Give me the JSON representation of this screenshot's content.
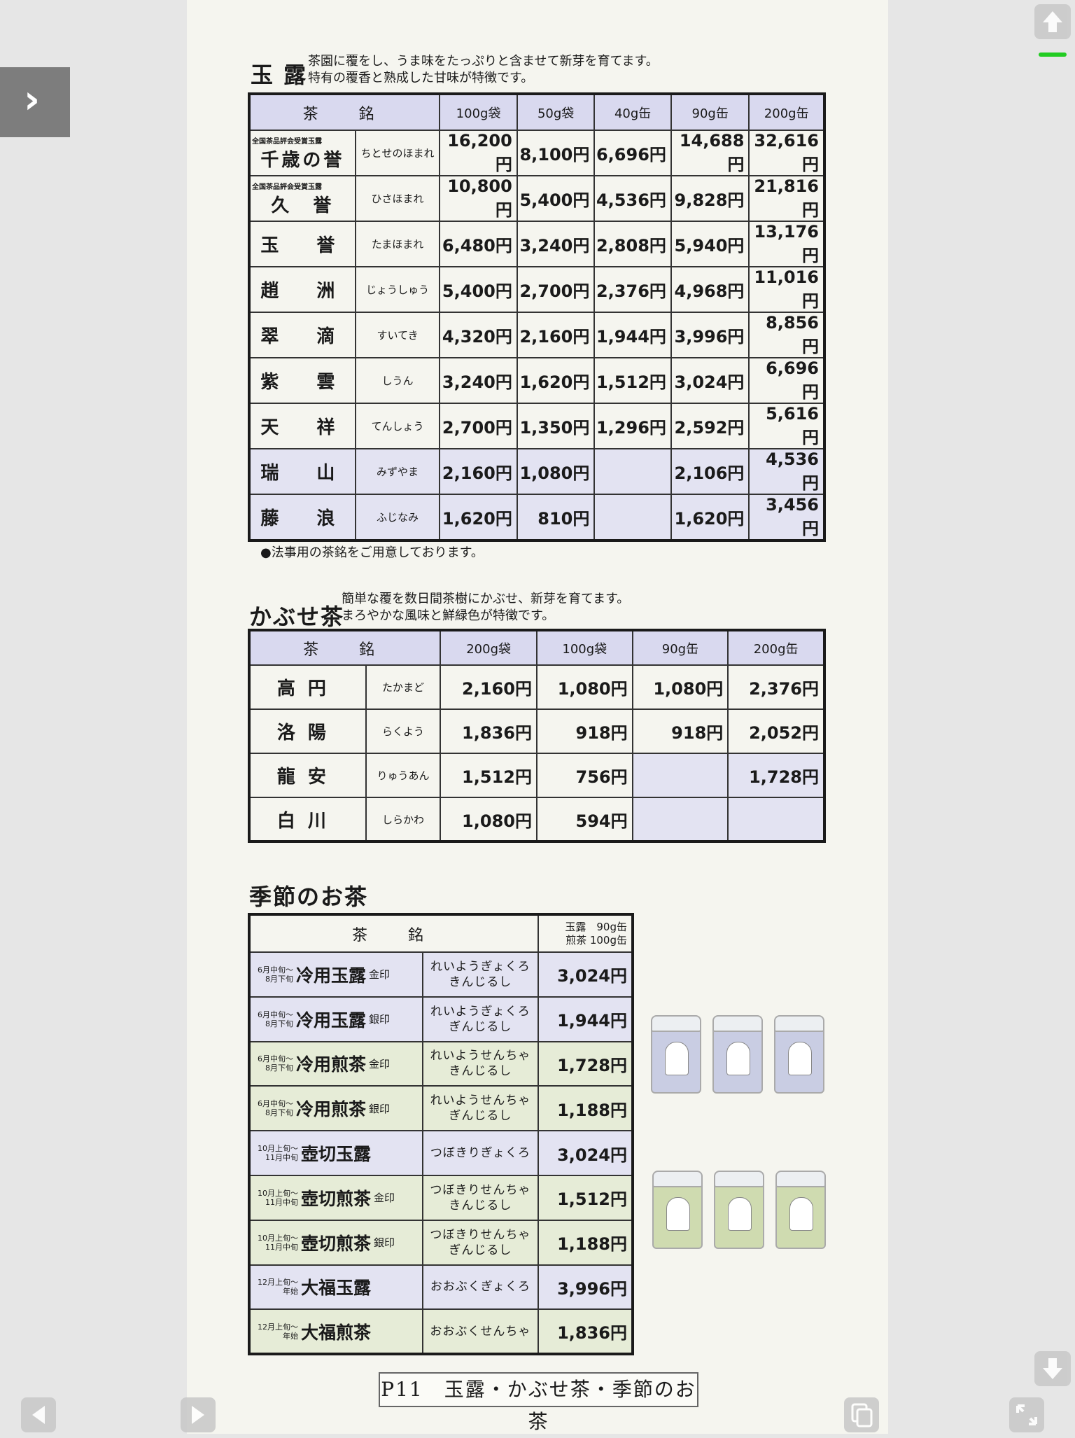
{
  "gyokuro": {
    "title": "玉 露",
    "desc": "茶園に覆をし、うま味をたっぷりと含ませて新芽を育てます。\n特有の覆香と熟成した甘味が特徴です。",
    "header": [
      "茶　銘",
      "100g袋",
      "50g袋",
      "40g缶",
      "90g缶",
      "200g缶"
    ],
    "rows": [
      {
        "award": "全国茶品評会受賞玉露",
        "name": "千歳の誉",
        "reading": "ちとせのほまれ",
        "prices": [
          "16,200円",
          "8,100円",
          "6,696円",
          "14,688円",
          "32,616円"
        ]
      },
      {
        "award": "全国茶品評会受賞玉露",
        "name": "久　誉",
        "reading": "ひさほまれ",
        "prices": [
          "10,800円",
          "5,400円",
          "4,536円",
          "9,828円",
          "21,816円"
        ]
      },
      {
        "award": "",
        "name": "玉　誉",
        "reading": "たまほまれ",
        "prices": [
          "6,480円",
          "3,240円",
          "2,808円",
          "5,940円",
          "13,176円"
        ]
      },
      {
        "award": "",
        "name": "趙　洲",
        "reading": "じょうしゅう",
        "prices": [
          "5,400円",
          "2,700円",
          "2,376円",
          "4,968円",
          "11,016円"
        ]
      },
      {
        "award": "",
        "name": "翠　滴",
        "reading": "すいてき",
        "prices": [
          "4,320円",
          "2,160円",
          "1,944円",
          "3,996円",
          "8,856円"
        ]
      },
      {
        "award": "",
        "name": "紫　雲",
        "reading": "しうん",
        "prices": [
          "3,240円",
          "1,620円",
          "1,512円",
          "3,024円",
          "6,696円"
        ]
      },
      {
        "award": "",
        "name": "天　祥",
        "reading": "てんしょう",
        "prices": [
          "2,700円",
          "1,350円",
          "1,296円",
          "2,592円",
          "5,616円"
        ]
      },
      {
        "award": "",
        "name": "瑞　山",
        "reading": "みずやま",
        "prices": [
          "2,160円",
          "1,080円",
          "",
          "2,106円",
          "4,536円"
        ]
      },
      {
        "award": "",
        "name": "藤　浪",
        "reading": "ふじなみ",
        "prices": [
          "1,620円",
          "810円",
          "",
          "1,620円",
          "3,456円"
        ]
      }
    ],
    "note": "●法事用の茶銘をご用意しております。"
  },
  "kabuse": {
    "title": "かぶせ茶",
    "desc": "簡単な覆を数日間茶樹にかぶせ、新芽を育てます。\nまろやかな風味と鮮緑色が特徴です。",
    "header": [
      "茶　銘",
      "200g袋",
      "100g袋",
      "90g缶",
      "200g缶"
    ],
    "rows": [
      {
        "name": "高円",
        "reading": "たかまど",
        "prices": [
          "2,160円",
          "1,080円",
          "1,080円",
          "2,376円"
        ]
      },
      {
        "name": "洛陽",
        "reading": "らくよう",
        "prices": [
          "1,836円",
          "918円",
          "918円",
          "2,052円"
        ]
      },
      {
        "name": "龍安",
        "reading": "りゅうあん",
        "prices": [
          "1,512円",
          "756円",
          "",
          "1,728円"
        ]
      },
      {
        "name": "白川",
        "reading": "しらかわ",
        "prices": [
          "1,080円",
          "594円",
          "",
          ""
        ]
      }
    ]
  },
  "season": {
    "title": "季節のお茶",
    "header_name": "茶　銘",
    "header_price_1": "玉露　90g缶",
    "header_price_2": "煎茶 100g缶",
    "rows": [
      {
        "period1": "6月中旬～",
        "period2": "8月下旬",
        "name": "冷用玉露",
        "grade": "金印",
        "reading1": "れいようぎょくろ",
        "reading2": "きんじるし",
        "price": "3,024円",
        "tone": "blue"
      },
      {
        "period1": "6月中旬～",
        "period2": "8月下旬",
        "name": "冷用玉露",
        "grade": "銀印",
        "reading1": "れいようぎょくろ",
        "reading2": "ぎんじるし",
        "price": "1,944円",
        "tone": "blue"
      },
      {
        "period1": "6月中旬～",
        "period2": "8月下旬",
        "name": "冷用煎茶",
        "grade": "金印",
        "reading1": "れいようせんちゃ",
        "reading2": "きんじるし",
        "price": "1,728円",
        "tone": "green"
      },
      {
        "period1": "6月中旬～",
        "period2": "8月下旬",
        "name": "冷用煎茶",
        "grade": "銀印",
        "reading1": "れいようせんちゃ",
        "reading2": "ぎんじるし",
        "price": "1,188円",
        "tone": "green"
      },
      {
        "period1": "10月上旬～",
        "period2": "11月中旬",
        "name": "壺切玉露",
        "grade": "",
        "reading1": "つぼきりぎょくろ",
        "reading2": "",
        "price": "3,024円",
        "tone": "blue"
      },
      {
        "period1": "10月上旬～",
        "period2": "11月中旬",
        "name": "壺切煎茶",
        "grade": "金印",
        "reading1": "つぼきりせんちゃ",
        "reading2": "きんじるし",
        "price": "1,512円",
        "tone": "green"
      },
      {
        "period1": "10月上旬～",
        "period2": "11月中旬",
        "name": "壺切煎茶",
        "grade": "銀印",
        "reading1": "つぼきりせんちゃ",
        "reading2": "ぎんじるし",
        "price": "1,188円",
        "tone": "green"
      },
      {
        "period1": "12月上旬～",
        "period2": "年始",
        "name": "大福玉露",
        "grade": "",
        "reading1": "おおぶくぎょくろ",
        "reading2": "",
        "price": "3,996円",
        "tone": "blue"
      },
      {
        "period1": "12月上旬～",
        "period2": "年始",
        "name": "大福煎茶",
        "grade": "",
        "reading1": "おおぶくせんちゃ",
        "reading2": "",
        "price": "1,836円",
        "tone": "green"
      }
    ]
  },
  "caption": "P11　玉露・かぶせ茶・季節のお茶",
  "colors": {
    "header_shade": "#d9d9ef",
    "blue_row": "#e3e3f2",
    "green_row": "#e6ecd7",
    "indicator": "#22cc22"
  },
  "icons": [
    "chevron-right-icon",
    "arrow-up-icon",
    "arrow-down-icon",
    "triangle-left-icon",
    "triangle-right-icon",
    "copy-pages-icon",
    "fullscreen-icon"
  ]
}
